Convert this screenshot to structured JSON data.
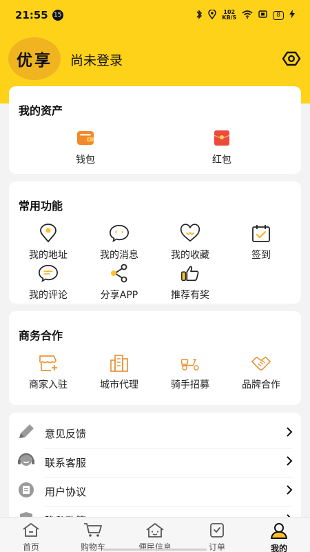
{
  "status_bar": {
    "time": "21:55",
    "notification_count": "15",
    "net_speed_value": "102",
    "net_speed_unit": "KB/S",
    "battery_level": "8"
  },
  "profile": {
    "avatar_text": "优享",
    "login_status": "尚未登录",
    "settings_icon": "settings-icon"
  },
  "assets": {
    "title": "我的资产",
    "items": [
      {
        "label": "钱包",
        "icon": "wallet-icon"
      },
      {
        "label": "红包",
        "icon": "red-envelope-icon"
      }
    ]
  },
  "common_functions": {
    "title": "常用功能",
    "items": [
      {
        "label": "我的地址",
        "icon": "location-icon"
      },
      {
        "label": "我的消息",
        "icon": "message-icon"
      },
      {
        "label": "我的收藏",
        "icon": "heart-icon"
      },
      {
        "label": "签到",
        "icon": "calendar-check-icon"
      },
      {
        "label": "我的评论",
        "icon": "comment-icon"
      },
      {
        "label": "分享APP",
        "icon": "share-icon"
      },
      {
        "label": "推荐有奖",
        "icon": "thumbs-up-icon"
      }
    ]
  },
  "business": {
    "title": "商务合作",
    "items": [
      {
        "label": "商家入驻",
        "icon": "store-add-icon"
      },
      {
        "label": "城市代理",
        "icon": "building-icon"
      },
      {
        "label": "骑手招募",
        "icon": "scooter-icon"
      },
      {
        "label": "品牌合作",
        "icon": "handshake-icon"
      }
    ]
  },
  "menu_list": [
    {
      "label": "意见反馈",
      "icon": "pencil-icon"
    },
    {
      "label": "联系客服",
      "icon": "headset-icon"
    },
    {
      "label": "用户协议",
      "icon": "document-icon"
    },
    {
      "label": "隐私政策",
      "icon": "shield-icon"
    }
  ],
  "tabbar": {
    "items": [
      {
        "label": "首页",
        "icon": "home-icon",
        "active": false
      },
      {
        "label": "购物车",
        "icon": "cart-icon",
        "active": false
      },
      {
        "label": "便民信息",
        "icon": "info-house-icon",
        "active": false
      },
      {
        "label": "订单",
        "icon": "order-icon",
        "active": false
      },
      {
        "label": "我的",
        "icon": "user-icon",
        "active": true
      }
    ]
  },
  "colors": {
    "accent_yellow": "#ffd21a",
    "avatar_bg": "#f0b421",
    "icon_orange": "#e99438",
    "red_envelope": "#ee4a3a"
  }
}
